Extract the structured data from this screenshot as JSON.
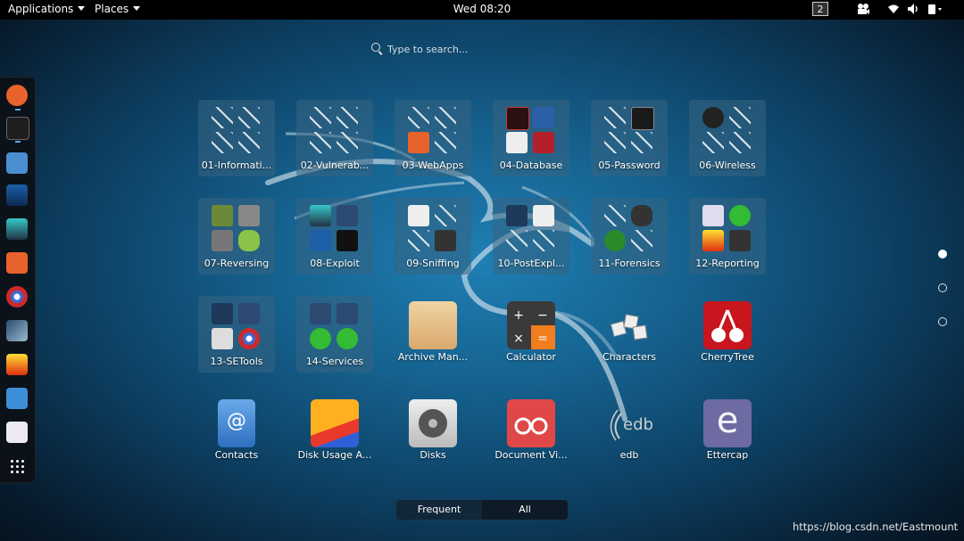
{
  "topbar": {
    "applications_label": "Applications",
    "places_label": "Places",
    "clock": "Wed 08:20",
    "workspace": "2",
    "icons": [
      "camera-icon",
      "wifi-icon",
      "volume-icon",
      "power-icon"
    ]
  },
  "search": {
    "placeholder": "Type to search..."
  },
  "dock": {
    "items": [
      "firefox-icon",
      "terminal-icon",
      "files-icon",
      "maltego-icon",
      "armitage-icon",
      "burpsuite-icon",
      "beef-icon",
      "metasploit-icon",
      "faraday-icon",
      "cutycapt-icon",
      "settings-icon"
    ],
    "show_apps_icon": "show-apps-grid-icon"
  },
  "folders": [
    {
      "label": "01-Informati..."
    },
    {
      "label": "02-Vulnerab..."
    },
    {
      "label": "03-WebApps"
    },
    {
      "label": "04-Database"
    },
    {
      "label": "05-Password"
    },
    {
      "label": "06-Wireless"
    },
    {
      "label": "07-Reversing"
    },
    {
      "label": "08-Exploit"
    },
    {
      "label": "09-Sniffing"
    },
    {
      "label": "10-PostExpl..."
    },
    {
      "label": "11-Forensics"
    },
    {
      "label": "12-Reporting"
    },
    {
      "label": "13-SETools"
    },
    {
      "label": "14-Services"
    }
  ],
  "apps": [
    {
      "label": "Archive Man..."
    },
    {
      "label": "Calculator"
    },
    {
      "label": "Characters"
    },
    {
      "label": "CherryTree"
    },
    {
      "label": "Contacts"
    },
    {
      "label": "Disk Usage A..."
    },
    {
      "label": "Disks"
    },
    {
      "label": "Document Vi..."
    },
    {
      "label": "edb"
    },
    {
      "label": "Ettercap"
    }
  ],
  "edb_logo_text": "edb",
  "ettercap_letter": "e",
  "contacts_symbol": "@",
  "view_switch": {
    "frequent": "Frequent",
    "all": "All",
    "active": "All"
  },
  "pages": {
    "count": 3,
    "current": 1
  },
  "watermark": "https://blog.csdn.net/Eastmount",
  "colors": {
    "accent": "#5aa9e6",
    "topbar": "#000000",
    "folder_bg": "#37647f"
  }
}
